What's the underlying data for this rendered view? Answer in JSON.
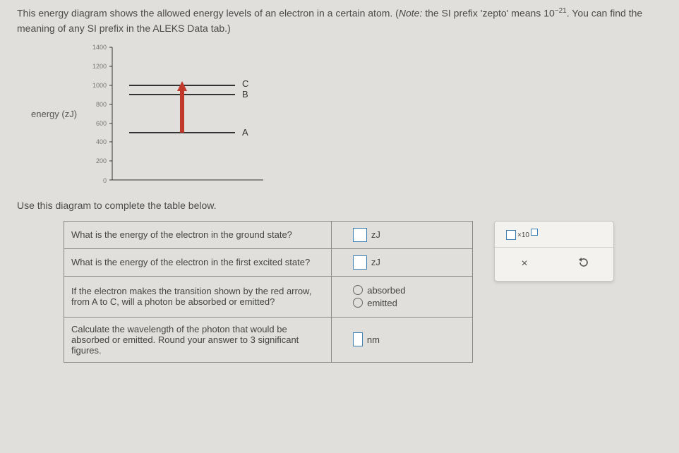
{
  "intro": {
    "part1": "This energy diagram shows the allowed energy levels of an electron in a certain atom. (",
    "note_label": "Note:",
    "part2": " the SI prefix 'zepto' means 10",
    "exp": "−21",
    "part3": ". You can find the meaning of any SI prefix in the ALEKS Data tab.)"
  },
  "chart_data": {
    "type": "other",
    "ylabel": "energy (zJ)",
    "ylim": [
      0,
      1400
    ],
    "yticks": [
      0,
      200,
      400,
      600,
      800,
      1000,
      1200,
      1400
    ],
    "levels": [
      {
        "name": "A",
        "value": 500
      },
      {
        "name": "B",
        "value": 900
      },
      {
        "name": "C",
        "value": 1000
      }
    ],
    "arrow": {
      "from": "A",
      "to": "C",
      "color": "#c0392b"
    }
  },
  "prompt2": "Use this diagram to complete the table below.",
  "questions": {
    "q1": "What is the energy of the electron in the ground state?",
    "q2": "What is the energy of the electron in the first excited state?",
    "q3": "If the electron makes the transition shown by the red arrow, from A to C, will a photon be absorbed or emitted?",
    "q4": "Calculate the wavelength of the photon that would be absorbed or emitted. Round your answer to 3 significant figures."
  },
  "answers": {
    "unit_zj": "zJ",
    "unit_nm": "nm",
    "radio_absorbed": "absorbed",
    "radio_emitted": "emitted"
  },
  "toolbox": {
    "sci_x10": "×10",
    "clear": "×",
    "reset": "↺"
  }
}
